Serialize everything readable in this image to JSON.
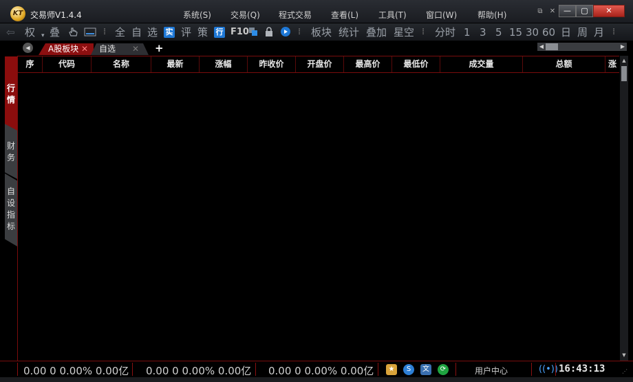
{
  "app": {
    "logo_text": "KT",
    "title": "交易师V1.4.4"
  },
  "menu": {
    "items": [
      "系统(S)",
      "交易(Q)",
      "程式交易",
      "查看(L)",
      "工具(T)",
      "窗口(W)",
      "帮助(H)"
    ]
  },
  "window_controls": {
    "restore": "⧉",
    "pin": "✕",
    "minimize": "—",
    "maximize": "▢",
    "close": "✕"
  },
  "toolbar": {
    "back": "⇦",
    "quan": "权",
    "die": "叠",
    "quan_full": "全",
    "zi": "自",
    "xuan": "选",
    "shi": "实",
    "ping": "评",
    "ce": "策",
    "hang": "行",
    "f10": "F10",
    "bankuai": "板块",
    "tongji": "统计",
    "diejia": "叠加",
    "xingkong": "星空",
    "fenshi": "分时",
    "p1": "1",
    "p3": "3",
    "p5": "5",
    "p15": "15",
    "p30": "30",
    "p60": "60",
    "ri": "日",
    "zhou": "周",
    "yue": "月"
  },
  "tabs": {
    "a_label": "A股板块",
    "zixuan_label": "自选",
    "add": "+"
  },
  "side_tabs": {
    "hangqing": [
      "行",
      "情"
    ],
    "caiwu": [
      "财",
      "务"
    ],
    "zishe": [
      "自",
      "设",
      "指",
      "标"
    ]
  },
  "table": {
    "columns": [
      "序",
      "代码",
      "名称",
      "最新",
      "涨幅",
      "昨收价",
      "开盘价",
      "最高价",
      "最低价",
      "成交量",
      "总额",
      "涨"
    ]
  },
  "status": {
    "index1": "0.00  0  0.00%  0.00亿",
    "index2": "0.00  0  0.00%  0.00亿",
    "index3": "0.00  0  0.00%  0.00亿",
    "user_center": "用户中心",
    "time": "16:43:13"
  }
}
